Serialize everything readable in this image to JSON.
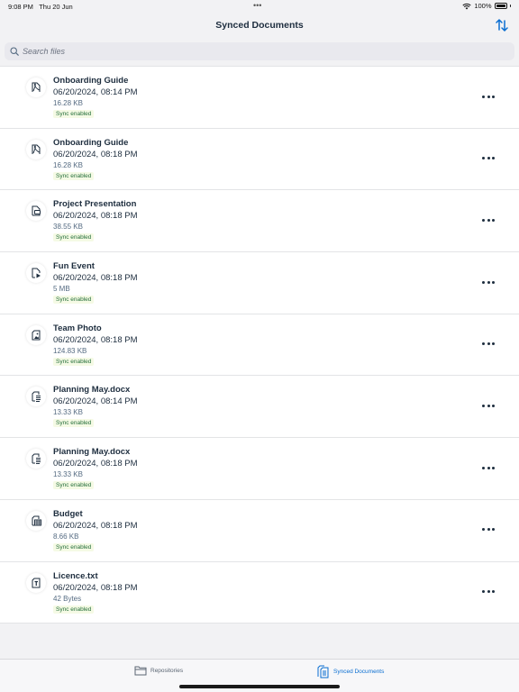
{
  "status_bar": {
    "time": "9:08 PM",
    "date": "Thu 20 Jun",
    "battery": "100%",
    "dots": "•••"
  },
  "header": {
    "title": "Synced Documents",
    "sort_icon": "sort-arrows-icon"
  },
  "search": {
    "placeholder": "Search files"
  },
  "files": [
    {
      "name": "Onboarding Guide",
      "date": "06/20/2024, 08:14 PM",
      "size": "16.28 KB",
      "status": "Sync enabled",
      "icon": "pdf-icon"
    },
    {
      "name": "Onboarding Guide",
      "date": "06/20/2024, 08:18 PM",
      "size": "16.28 KB",
      "status": "Sync enabled",
      "icon": "pdf-icon"
    },
    {
      "name": "Project Presentation",
      "date": "06/20/2024, 08:18 PM",
      "size": "38.55 KB",
      "status": "Sync enabled",
      "icon": "presentation-icon"
    },
    {
      "name": "Fun Event",
      "date": "06/20/2024, 08:18 PM",
      "size": "5 MB",
      "status": "Sync enabled",
      "icon": "video-icon"
    },
    {
      "name": "Team Photo",
      "date": "06/20/2024, 08:18 PM",
      "size": "124.83 KB",
      "status": "Sync enabled",
      "icon": "image-icon"
    },
    {
      "name": "Planning May.docx",
      "date": "06/20/2024, 08:14 PM",
      "size": "13.33 KB",
      "status": "Sync enabled",
      "icon": "document-icon"
    },
    {
      "name": "Planning May.docx",
      "date": "06/20/2024, 08:18 PM",
      "size": "13.33 KB",
      "status": "Sync enabled",
      "icon": "document-icon"
    },
    {
      "name": "Budget",
      "date": "06/20/2024, 08:18 PM",
      "size": "8.66 KB",
      "status": "Sync enabled",
      "icon": "spreadsheet-icon"
    },
    {
      "name": "Licence.txt",
      "date": "06/20/2024, 08:18 PM",
      "size": "42 Bytes",
      "status": "Sync enabled",
      "icon": "text-file-icon"
    }
  ],
  "tabs": [
    {
      "label": "Repositories",
      "icon": "folder-icon",
      "selected": false
    },
    {
      "label": "Synced Documents",
      "icon": "synced-documents-icon",
      "selected": true
    }
  ],
  "colors": {
    "accent": "#0a6ed1",
    "text": "#1d2d3e",
    "sync_badge": "#256f3a"
  }
}
